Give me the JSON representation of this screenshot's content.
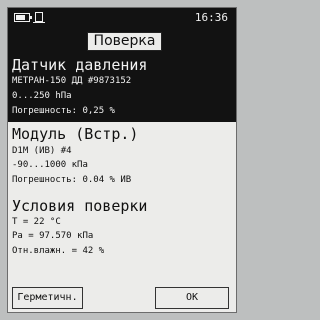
{
  "status": {
    "time": "16:36",
    "battery_level": 0.7
  },
  "header": {
    "title": "Поверка"
  },
  "sensor": {
    "name": "Датчик давления",
    "model": "МЕТРАН-150 ДД #9873152",
    "range": "0...250 hПа",
    "error": "Погрешность: 0,25 %"
  },
  "module": {
    "title": "Модуль (Встр.)",
    "id": "D1M (ИВ) #4",
    "range": "-90...1000 кПа",
    "error": "Погрешность: 0.04 % ИВ"
  },
  "conditions": {
    "title": "Условия поверки",
    "temperature": "T = 22 °C",
    "pressure": "Pa = 97.570 кПа",
    "humidity": "Отн.влажн. = 42 %"
  },
  "buttons": {
    "left_label": "Герметичн.",
    "right_label": "OK"
  }
}
